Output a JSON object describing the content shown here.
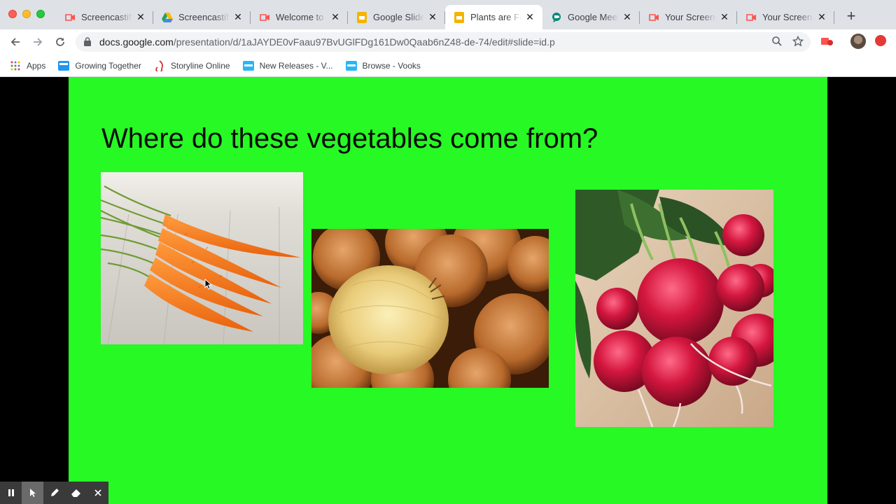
{
  "browser": {
    "tabs": [
      {
        "title": "Screencastify",
        "icon": "screencastify-icon",
        "active": false
      },
      {
        "title": "Screencastify",
        "icon": "google-drive-icon",
        "active": false
      },
      {
        "title": "Welcome to Screencastify",
        "icon": "screencastify-icon",
        "active": false
      },
      {
        "title": "Google Slides",
        "icon": "google-slides-icon",
        "active": false
      },
      {
        "title": "Plants are Fruits",
        "icon": "google-slides-icon",
        "active": true
      },
      {
        "title": "Google Meet",
        "icon": "google-meet-icon",
        "active": false
      },
      {
        "title": "Your Screencastify",
        "icon": "screencastify-icon",
        "active": false
      },
      {
        "title": "Your Screencastify",
        "icon": "screencastify-icon",
        "active": false
      }
    ],
    "url_host": "docs.google.com",
    "url_path": "/presentation/d/1aJAYDE0vFaau97BvUGlFDg161Dw0Qaab6nZ48-de-74/edit#slide=id.p",
    "bookmarks": [
      {
        "label": "Apps",
        "icon": "apps-grid-icon"
      },
      {
        "label": "Growing Together",
        "icon": "growing-together-icon"
      },
      {
        "label": "Storyline Online",
        "icon": "storyline-online-icon"
      },
      {
        "label": "New Releases - V...",
        "icon": "vooks-icon"
      },
      {
        "label": "Browse - Vooks",
        "icon": "vooks-icon"
      }
    ]
  },
  "slide": {
    "title": "Where do these vegetables come from?",
    "background": "#26f924",
    "images": [
      "carrots",
      "onions",
      "radishes"
    ]
  },
  "colors": {
    "tabstrip": "#dee1e6",
    "slides_yellow": "#f4b400",
    "screencastify_red": "#ff5252"
  }
}
